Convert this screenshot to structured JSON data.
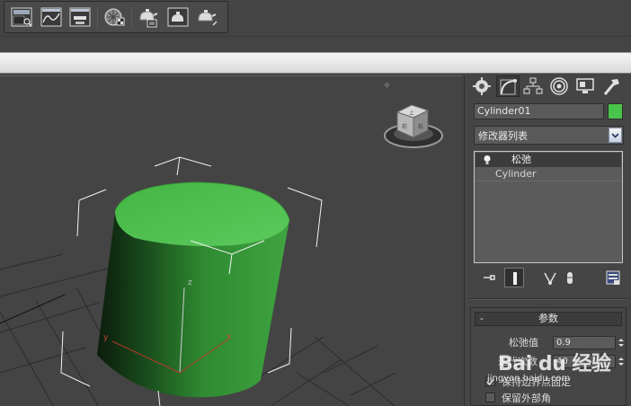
{
  "toolbar": {
    "buttons": [
      {
        "name": "scene-explorer-icon"
      },
      {
        "name": "curve-editor-icon"
      },
      {
        "name": "schematic-view-icon"
      },
      {
        "name": "material-editor-icon"
      },
      {
        "name": "render-setup-icon"
      },
      {
        "name": "rendered-frame-window-icon"
      },
      {
        "name": "render-production-icon"
      }
    ]
  },
  "command_panel": {
    "tabs": [
      "create-icon",
      "modify-icon",
      "hierarchy-icon",
      "motion-icon",
      "display-icon",
      "utilities-icon"
    ],
    "active_tab": "modify-icon",
    "object_name": "Cylinder01",
    "object_color": "#49c44a",
    "modifier_list_label": "修改器列表",
    "stack": {
      "modifier": "松弛",
      "base_object": "Cylinder"
    },
    "parameters": {
      "rollout_minus": "-",
      "rollout_title": "参数",
      "relax_value_label": "松弛值",
      "relax_value": "0.9",
      "iterations_label": "迭代次数",
      "iterations_value": "40",
      "keep_boundary_label": "保持边界点固定",
      "keep_boundary_checked": true,
      "keep_outer_label": "保留外部角",
      "keep_outer_checked": false
    }
  },
  "viewport": {
    "axis_labels": {
      "x": "x",
      "y": "y",
      "z": "z"
    },
    "viewcube_faces": {
      "top": "上",
      "front": "前",
      "right": "右"
    }
  },
  "watermark": {
    "brand": "Bai du 经验",
    "url": "jingyan.baidu.com"
  },
  "colors": {
    "cylinder_top": "#4fbf4f",
    "cylinder_side": "#3ea43e",
    "viewport_bg": "#444444",
    "grid": "#2c2c2c"
  }
}
